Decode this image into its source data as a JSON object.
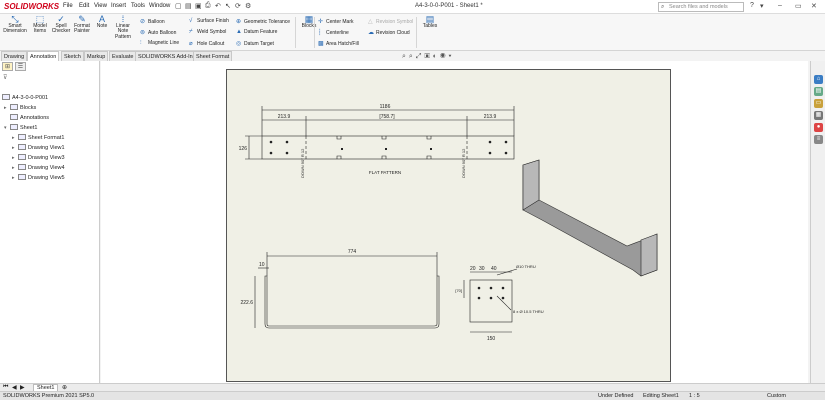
{
  "app": {
    "logo": "SOLIDWORKS",
    "menu": [
      "File",
      "Edit",
      "View",
      "Insert",
      "Tools",
      "Window"
    ],
    "document_title": "A4-3-0-0-P001 - Sheet1 *",
    "search_placeholder": "Search files and models"
  },
  "ribbon": {
    "smart_dimension": "Smart Dimension",
    "model_items": "Model Items",
    "spell_checker": "Spell Checker",
    "format_painter": "Format Painter",
    "note": "Note",
    "linear_note_pattern": "Linear Note Pattern",
    "balloon": "Balloon",
    "auto_balloon": "Auto Balloon",
    "magnetic_line": "Magnetic Line",
    "surface_finish": "Surface Finish",
    "weld_symbol": "Weld Symbol",
    "hole_callout": "Hole Callout",
    "geometric_tolerance": "Geometric Tolerance",
    "datum_feature": "Datum Feature",
    "datum_target": "Datum Target",
    "blocks": "Blocks",
    "center_mark": "Center Mark",
    "centerline": "Centerline",
    "area_hatch": "Area Hatch/Fill",
    "revision_symbol": "Revision Symbol",
    "revision_cloud": "Revision Cloud",
    "tables": "Tables"
  },
  "tabs": [
    "Drawing",
    "Annotation",
    "Sketch",
    "Markup",
    "Evaluate",
    "SOLIDWORKS Add-Ins",
    "Sheet Format"
  ],
  "tree": {
    "root": "A4-3-0-0-P001",
    "blocks": "Blocks",
    "annotations": "Annotations",
    "sheet": "Sheet1",
    "sheet_format": "Sheet Format1",
    "views": [
      "Drawing View1",
      "Drawing View3",
      "Drawing View4",
      "Drawing View5"
    ]
  },
  "drawing": {
    "flat": {
      "overall": "1186",
      "left_seg": "213.9",
      "mid_seg": "[758.7]",
      "right_seg": "213.9",
      "height": "126",
      "bend_left": "DOWN 90° R 12",
      "bend_right": "DOWN 90° R 12",
      "caption": "FLAT PATTERN"
    },
    "front": {
      "width": "774",
      "flange": "10",
      "height": "222.6"
    },
    "side": {
      "d1": "20",
      "d2": "30",
      "d3": "40",
      "hole_spacing": "[70]",
      "hole_note": "Ø10 THRU",
      "hole_callout": "8 x Ø 10.5 THRU",
      "width": "150"
    }
  },
  "sheet_tab": "Sheet1",
  "status": {
    "version": "SOLIDWORKS Premium 2021 SP5.0",
    "defined": "Under Defined",
    "editing": "Editing Sheet1",
    "scale": "1 : 5",
    "units": "Custom"
  },
  "colors": {
    "accent": "#d0021b",
    "sheet": "#f0f0e6",
    "icon_blue": "#2a6bb4"
  }
}
